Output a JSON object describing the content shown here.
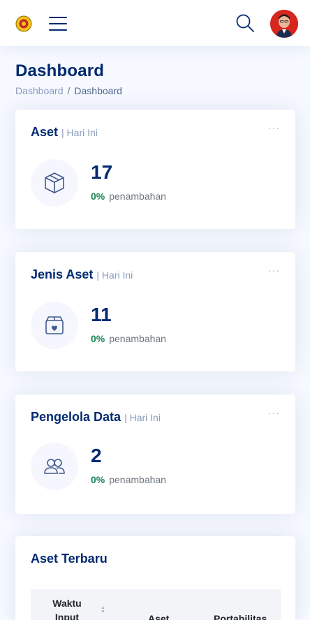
{
  "header": {
    "logo_icon": "university-logo-icon",
    "menu_icon": "hamburger-menu-icon",
    "search_icon": "search-icon",
    "avatar_icon": "user-avatar"
  },
  "pagetitle": {
    "title": "Dashboard",
    "breadcrumb": [
      "Dashboard",
      "/",
      "Dashboard"
    ]
  },
  "cards": [
    {
      "title": "Aset",
      "subtitle": "| Hari Ini",
      "value": "17",
      "pct": "0%",
      "change_label": "penambahan",
      "icon": "box-icon"
    },
    {
      "title": "Jenis Aset",
      "subtitle": "| Hari Ini",
      "value": "11",
      "pct": "0%",
      "change_label": "penambahan",
      "icon": "box-heart-icon"
    },
    {
      "title": "Pengelola Data",
      "subtitle": "| Hari Ini",
      "value": "2",
      "pct": "0%",
      "change_label": "penambahan",
      "icon": "people-icon"
    }
  ],
  "dots": "···",
  "table": {
    "title": "Aset Terbaru",
    "columns": [
      "Waktu Input",
      "Aset",
      "Portabilitas"
    ]
  },
  "colors": {
    "primary": "#012970",
    "muted": "#899bbd",
    "success": "#198754",
    "background": "#f6f9ff"
  }
}
